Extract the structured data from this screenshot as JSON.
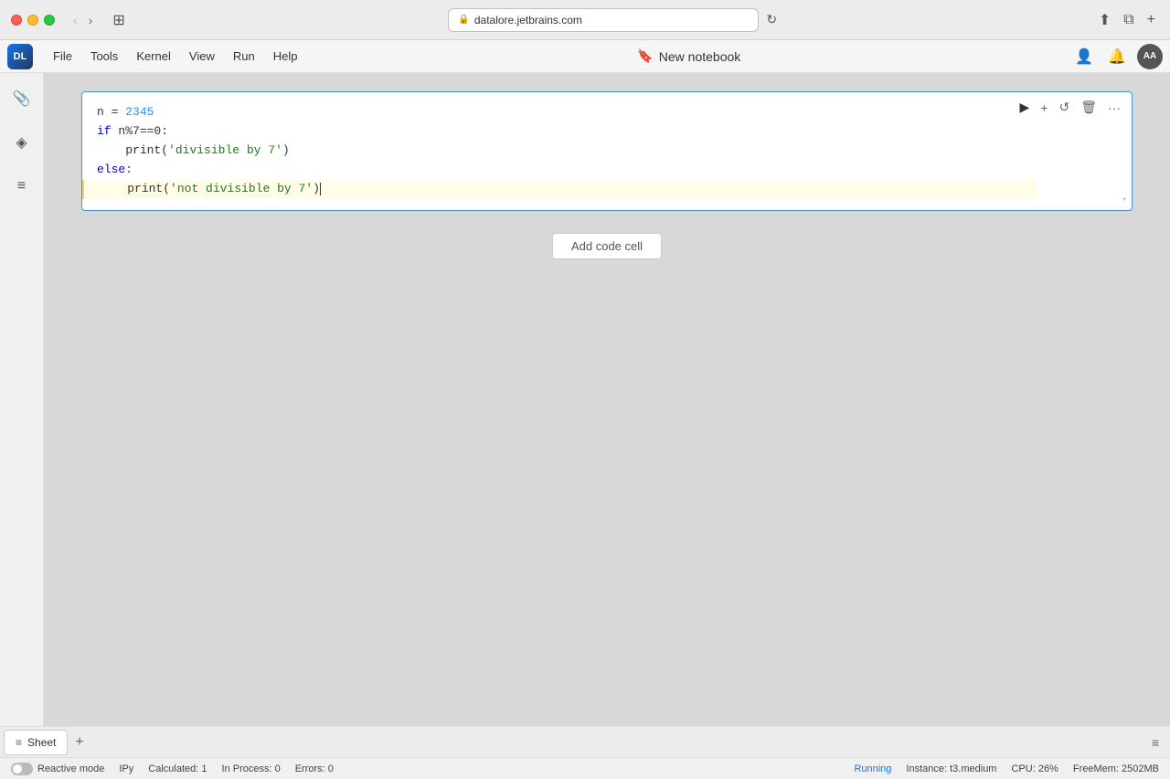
{
  "titlebar": {
    "url": "datalore.jetbrains.com",
    "back_label": "‹",
    "forward_label": "›",
    "sidebar_toggle": "⊞",
    "refresh_label": "↻",
    "share_label": "⬆",
    "tab_icon": "⧉",
    "new_tab": "+"
  },
  "menubar": {
    "logo": "DL",
    "items": [
      "File",
      "Tools",
      "Kernel",
      "View",
      "Run",
      "Help"
    ],
    "title": "New notebook",
    "bookmark_icon": "🔖",
    "right_icons": [
      "👤",
      "🔔"
    ],
    "avatar_label": "AA"
  },
  "sidebar": {
    "icons": [
      "📎",
      "◈",
      "≡"
    ]
  },
  "cell": {
    "toolbar": {
      "run_btn": "▶",
      "add_btn": "+",
      "refresh_btn": "↺",
      "delete_btn": "🗑",
      "more_btn": "···"
    },
    "code_lines": [
      "n = 2345",
      "if n%7==0:",
      "    print('divisible by 7')",
      "else:",
      "    print('not divisible by 7')"
    ],
    "star": "*"
  },
  "add_cell_button": "Add code cell",
  "tabs": {
    "items": [
      {
        "label": "Sheet",
        "icon": "≡"
      }
    ],
    "add_label": "+"
  },
  "statusbar": {
    "reactive_mode_label": "Reactive mode",
    "kernel_label": "IPy",
    "calculated_label": "Calculated: 1",
    "in_process_label": "In Process: 0",
    "errors_label": "Errors: 0",
    "running_label": "Running",
    "instance_label": "Instance: t3.medium",
    "cpu_label": "CPU: 26%",
    "freemem_label": "FreeMem: 2502MB"
  }
}
